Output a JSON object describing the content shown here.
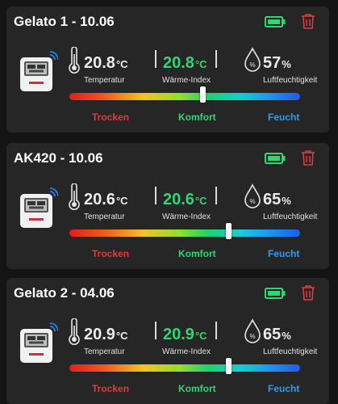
{
  "colors": {
    "accent_green": "#2fd675",
    "humidity_blue": "#2f9cf0",
    "dry_red": "#e23a3a",
    "trash_red": "#d74141"
  },
  "scale_labels": {
    "dry": "Trocken",
    "comfort": "Komfort",
    "wet": "Feucht"
  },
  "cards": [
    {
      "title": "Gelato 1 - 10.06",
      "temperature": {
        "value": "20.8",
        "unit": "°C",
        "label": "Temperatur"
      },
      "heat_index": {
        "value": "20.8",
        "unit": "°C",
        "label": "Wärme-Index"
      },
      "humidity": {
        "value": "57",
        "unit": "%",
        "label": "Luftfeuchtigkeit"
      },
      "comfort_level": 0.58,
      "battery": 1.0,
      "icons": [
        "battery-icon",
        "trash-icon",
        "hygrometer-device-icon",
        "thermometer-icon",
        "humidity-drop-icon",
        "wifi-icon"
      ]
    },
    {
      "title": "AK420 - 10.06",
      "temperature": {
        "value": "20.6",
        "unit": "°C",
        "label": "Temperatur"
      },
      "heat_index": {
        "value": "20.6",
        "unit": "°C",
        "label": "Wärme-Index"
      },
      "humidity": {
        "value": "65",
        "unit": "%",
        "label": "Luftfeuchtigkeit"
      },
      "comfort_level": 0.69,
      "battery": 1.0,
      "icons": [
        "battery-icon",
        "trash-icon",
        "hygrometer-device-icon",
        "thermometer-icon",
        "humidity-drop-icon",
        "wifi-icon"
      ]
    },
    {
      "title": "Gelato 2 - 04.06",
      "temperature": {
        "value": "20.9",
        "unit": "°C",
        "label": "Temperatur"
      },
      "heat_index": {
        "value": "20.9",
        "unit": "°C",
        "label": "Wärme-Index"
      },
      "humidity": {
        "value": "65",
        "unit": "%",
        "label": "Luftfeuchtigkeit"
      },
      "comfort_level": 0.69,
      "battery": 1.0,
      "icons": [
        "battery-icon",
        "trash-icon",
        "hygrometer-device-icon",
        "thermometer-icon",
        "humidity-drop-icon",
        "wifi-icon"
      ]
    }
  ]
}
